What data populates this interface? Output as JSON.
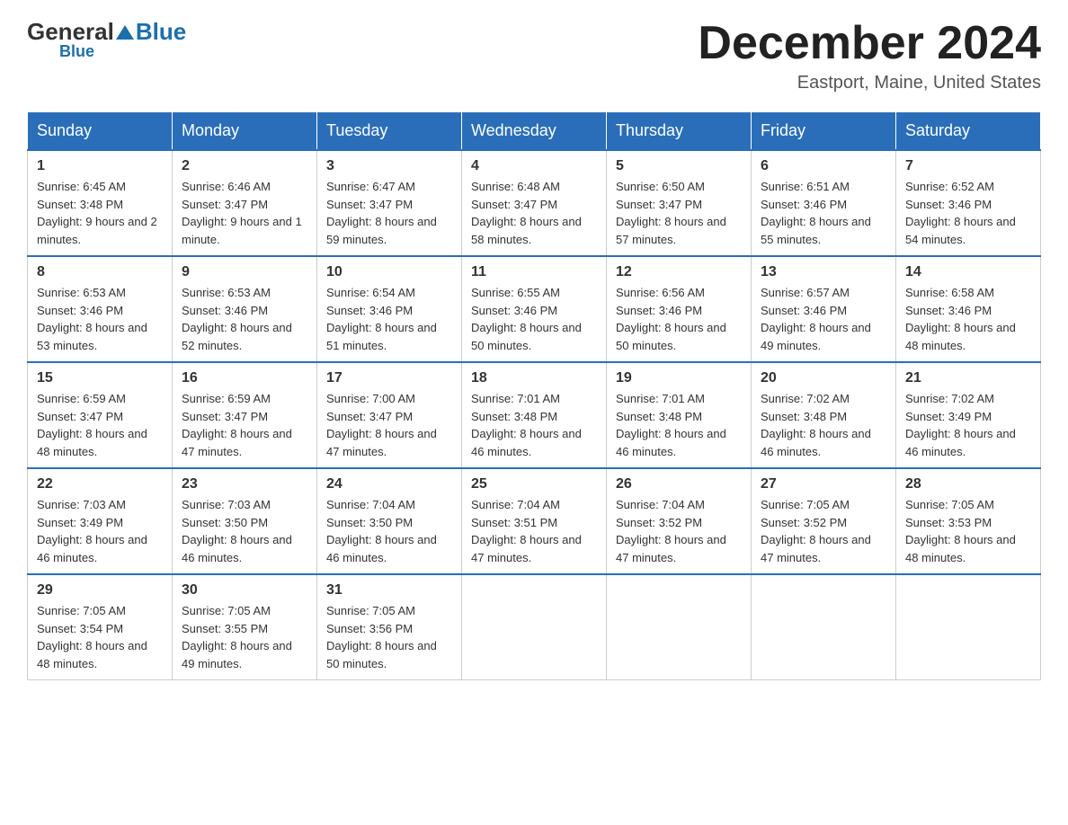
{
  "header": {
    "logo": {
      "general": "General",
      "blue": "Blue"
    },
    "title": "December 2024",
    "location": "Eastport, Maine, United States"
  },
  "days_of_week": [
    "Sunday",
    "Monday",
    "Tuesday",
    "Wednesday",
    "Thursday",
    "Friday",
    "Saturday"
  ],
  "weeks": [
    [
      {
        "day": "1",
        "sunrise": "6:45 AM",
        "sunset": "3:48 PM",
        "daylight": "9 hours and 2 minutes."
      },
      {
        "day": "2",
        "sunrise": "6:46 AM",
        "sunset": "3:47 PM",
        "daylight": "9 hours and 1 minute."
      },
      {
        "day": "3",
        "sunrise": "6:47 AM",
        "sunset": "3:47 PM",
        "daylight": "8 hours and 59 minutes."
      },
      {
        "day": "4",
        "sunrise": "6:48 AM",
        "sunset": "3:47 PM",
        "daylight": "8 hours and 58 minutes."
      },
      {
        "day": "5",
        "sunrise": "6:50 AM",
        "sunset": "3:47 PM",
        "daylight": "8 hours and 57 minutes."
      },
      {
        "day": "6",
        "sunrise": "6:51 AM",
        "sunset": "3:46 PM",
        "daylight": "8 hours and 55 minutes."
      },
      {
        "day": "7",
        "sunrise": "6:52 AM",
        "sunset": "3:46 PM",
        "daylight": "8 hours and 54 minutes."
      }
    ],
    [
      {
        "day": "8",
        "sunrise": "6:53 AM",
        "sunset": "3:46 PM",
        "daylight": "8 hours and 53 minutes."
      },
      {
        "day": "9",
        "sunrise": "6:53 AM",
        "sunset": "3:46 PM",
        "daylight": "8 hours and 52 minutes."
      },
      {
        "day": "10",
        "sunrise": "6:54 AM",
        "sunset": "3:46 PM",
        "daylight": "8 hours and 51 minutes."
      },
      {
        "day": "11",
        "sunrise": "6:55 AM",
        "sunset": "3:46 PM",
        "daylight": "8 hours and 50 minutes."
      },
      {
        "day": "12",
        "sunrise": "6:56 AM",
        "sunset": "3:46 PM",
        "daylight": "8 hours and 50 minutes."
      },
      {
        "day": "13",
        "sunrise": "6:57 AM",
        "sunset": "3:46 PM",
        "daylight": "8 hours and 49 minutes."
      },
      {
        "day": "14",
        "sunrise": "6:58 AM",
        "sunset": "3:46 PM",
        "daylight": "8 hours and 48 minutes."
      }
    ],
    [
      {
        "day": "15",
        "sunrise": "6:59 AM",
        "sunset": "3:47 PM",
        "daylight": "8 hours and 48 minutes."
      },
      {
        "day": "16",
        "sunrise": "6:59 AM",
        "sunset": "3:47 PM",
        "daylight": "8 hours and 47 minutes."
      },
      {
        "day": "17",
        "sunrise": "7:00 AM",
        "sunset": "3:47 PM",
        "daylight": "8 hours and 47 minutes."
      },
      {
        "day": "18",
        "sunrise": "7:01 AM",
        "sunset": "3:48 PM",
        "daylight": "8 hours and 46 minutes."
      },
      {
        "day": "19",
        "sunrise": "7:01 AM",
        "sunset": "3:48 PM",
        "daylight": "8 hours and 46 minutes."
      },
      {
        "day": "20",
        "sunrise": "7:02 AM",
        "sunset": "3:48 PM",
        "daylight": "8 hours and 46 minutes."
      },
      {
        "day": "21",
        "sunrise": "7:02 AM",
        "sunset": "3:49 PM",
        "daylight": "8 hours and 46 minutes."
      }
    ],
    [
      {
        "day": "22",
        "sunrise": "7:03 AM",
        "sunset": "3:49 PM",
        "daylight": "8 hours and 46 minutes."
      },
      {
        "day": "23",
        "sunrise": "7:03 AM",
        "sunset": "3:50 PM",
        "daylight": "8 hours and 46 minutes."
      },
      {
        "day": "24",
        "sunrise": "7:04 AM",
        "sunset": "3:50 PM",
        "daylight": "8 hours and 46 minutes."
      },
      {
        "day": "25",
        "sunrise": "7:04 AM",
        "sunset": "3:51 PM",
        "daylight": "8 hours and 47 minutes."
      },
      {
        "day": "26",
        "sunrise": "7:04 AM",
        "sunset": "3:52 PM",
        "daylight": "8 hours and 47 minutes."
      },
      {
        "day": "27",
        "sunrise": "7:05 AM",
        "sunset": "3:52 PM",
        "daylight": "8 hours and 47 minutes."
      },
      {
        "day": "28",
        "sunrise": "7:05 AM",
        "sunset": "3:53 PM",
        "daylight": "8 hours and 48 minutes."
      }
    ],
    [
      {
        "day": "29",
        "sunrise": "7:05 AM",
        "sunset": "3:54 PM",
        "daylight": "8 hours and 48 minutes."
      },
      {
        "day": "30",
        "sunrise": "7:05 AM",
        "sunset": "3:55 PM",
        "daylight": "8 hours and 49 minutes."
      },
      {
        "day": "31",
        "sunrise": "7:05 AM",
        "sunset": "3:56 PM",
        "daylight": "8 hours and 50 minutes."
      },
      null,
      null,
      null,
      null
    ]
  ],
  "labels": {
    "sunrise": "Sunrise:",
    "sunset": "Sunset:",
    "daylight": "Daylight:"
  }
}
